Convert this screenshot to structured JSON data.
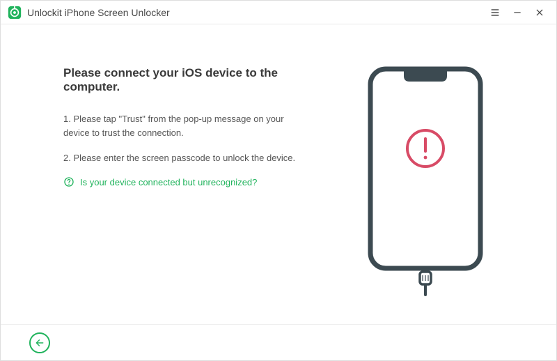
{
  "titlebar": {
    "title": "Unlockit iPhone Screen Unlocker"
  },
  "main": {
    "heading": "Please connect your iOS device to the computer.",
    "step1": "1. Please tap \"Trust\" from the pop-up message on your device to trust the connection.",
    "step2": "2. Please enter the screen passcode to unlock the device.",
    "help_link": "Is your device connected but unrecognized?"
  },
  "colors": {
    "accent": "#20b35c",
    "alert": "#d84b66",
    "phone": "#3c4a51"
  }
}
